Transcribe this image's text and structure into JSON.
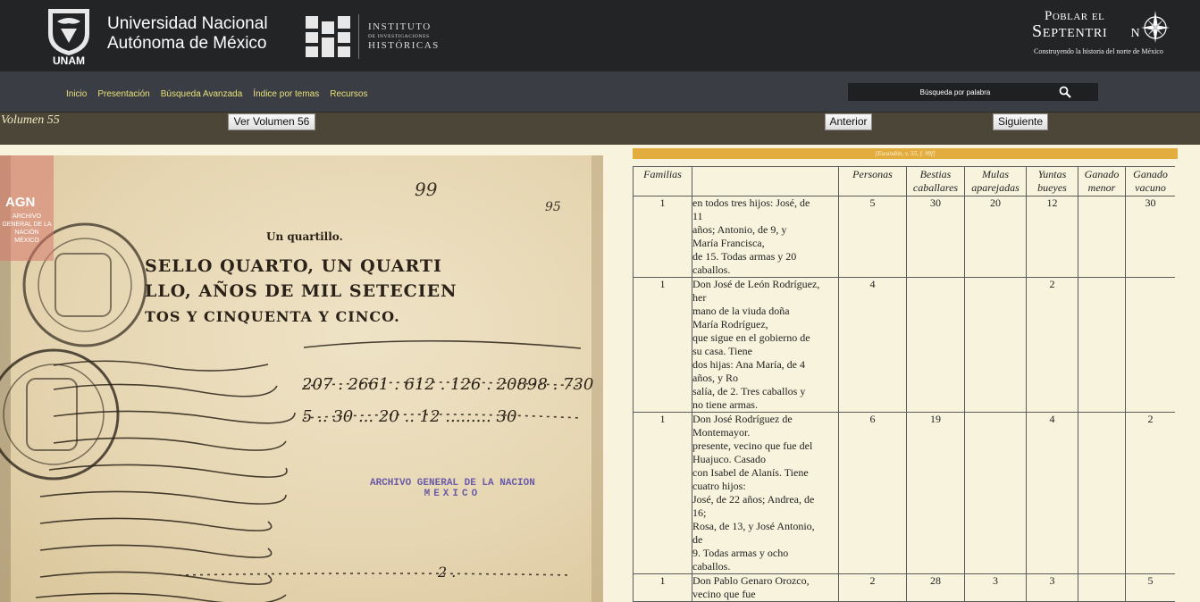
{
  "header": {
    "university_logo_text": "UNAM",
    "university_line1": "Universidad Nacional",
    "university_line2": "Autónoma de México",
    "institute_line1": "INSTITUTO",
    "institute_line2": "DE INVESTIGACIONES",
    "institute_line3": "HISTÓRICAS",
    "project_line1": "Poblar el",
    "project_line2": "Septentri",
    "project_line2_end": "n",
    "project_tagline": "Construyendo la historia del norte de México"
  },
  "nav": {
    "items": [
      {
        "label": "Inicio"
      },
      {
        "label": "Presentación"
      },
      {
        "label": "Búsqueda Avanzada"
      },
      {
        "label": "Índice por temas"
      },
      {
        "label": "Recursos"
      }
    ],
    "search_placeholder": "Búsqueda por palabra"
  },
  "volume": {
    "title": "Volumen 55",
    "view_button": "Ver Volumen 56",
    "prev_button": "Anterior",
    "next_button": "Siguiente"
  },
  "manuscript": {
    "agn_logo": "AGN",
    "agn_small": "ARCHIVO GENERAL DE LA NACIÓN MÉXICO",
    "page_numbers": [
      "99",
      "95"
    ],
    "stamp_line1": "ARCHIVO GENERAL DE LA NACION",
    "stamp_line2": "MEXICO",
    "header_text": [
      "Un quartillo.",
      "SELLO QUARTO, UN QUARTI",
      "LLO, AÑOS DE MIL SETECIEN",
      "TOS Y CINQUENTA Y CINCO."
    ]
  },
  "reference": "[Escandón, v. 55, f. 99f]",
  "table": {
    "headers": [
      {
        "line1": "Familias",
        "line2": ""
      },
      {
        "line1": "",
        "line2": ""
      },
      {
        "line1": "Personas",
        "line2": ""
      },
      {
        "line1": "Bestias",
        "line2": "caballares"
      },
      {
        "line1": "Mulas",
        "line2": "aparejadas"
      },
      {
        "line1": "Yuntas",
        "line2": "bueyes"
      },
      {
        "line1": "Ganado",
        "line2": "menor"
      },
      {
        "line1": "Ganado",
        "line2": "vacuno"
      }
    ],
    "rows": [
      {
        "familias": "1",
        "description": [
          "en todos tres hijos: José, de",
          "11",
          "años; Antonio, de 9, y",
          "María Francisca,",
          "de 15. Todas armas y 20",
          "caballos."
        ],
        "personas": "5",
        "bestias": "30",
        "mulas": "20",
        "yuntas": "12",
        "menor": "",
        "vacuno": "30"
      },
      {
        "familias": "1",
        "description": [
          "Don José de León Rodríguez,",
          "her",
          "mano de la viuda doña",
          "María Rodríguez,",
          "que sigue en el gobierno de",
          "su casa. Tiene",
          "dos hijas: Ana María, de 4",
          "años, y Ro",
          "salía, de 2. Tres caballos y",
          "no tiene armas."
        ],
        "personas": "4",
        "bestias": "",
        "mulas": "",
        "yuntas": "2",
        "menor": "",
        "vacuno": ""
      },
      {
        "familias": "1",
        "description": [
          "Don José Rodríguez de",
          "Montemayor.",
          "presente, vecino que fue del",
          "Huajuco. Casado",
          "con Isabel de Alanís. Tiene",
          "cuatro hijos:",
          "José, de 22 años; Andrea, de",
          "16;",
          "Rosa, de 13, y José Antonio,",
          "de",
          "9. Todas armas y ocho",
          "caballos."
        ],
        "personas": "6",
        "bestias": "19",
        "mulas": "",
        "yuntas": "4",
        "menor": "",
        "vacuno": "2"
      },
      {
        "familias": "1",
        "description": [
          "Don Pablo Genaro Orozco,",
          "vecino que fue"
        ],
        "personas": "2",
        "bestias": "28",
        "mulas": "3",
        "yuntas": "3",
        "menor": "",
        "vacuno": "5"
      }
    ]
  }
}
